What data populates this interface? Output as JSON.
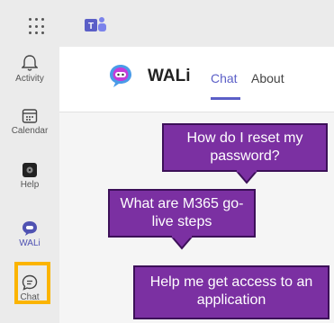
{
  "rail": {
    "items": [
      {
        "label": "Activity",
        "icon": "bell-icon"
      },
      {
        "label": "Calendar",
        "icon": "calendar-icon"
      },
      {
        "label": "Help",
        "icon": "help-icon"
      },
      {
        "label": "WALi",
        "icon": "wali-bot-icon"
      },
      {
        "label": "Chat",
        "icon": "chat-icon"
      }
    ]
  },
  "header": {
    "app_name": "WALi",
    "tabs": [
      {
        "label": "Chat",
        "active": true
      },
      {
        "label": "About",
        "active": false
      }
    ]
  },
  "callouts": [
    {
      "text": "How do I reset my password?"
    },
    {
      "text": "What are M365 go-live steps"
    },
    {
      "text": "Help me get access to an application"
    }
  ],
  "colors": {
    "accent": "#5b5fc7",
    "selection_highlight": "#fbb400",
    "callout_fill": "#7b30a2",
    "callout_border": "#3c1058"
  }
}
